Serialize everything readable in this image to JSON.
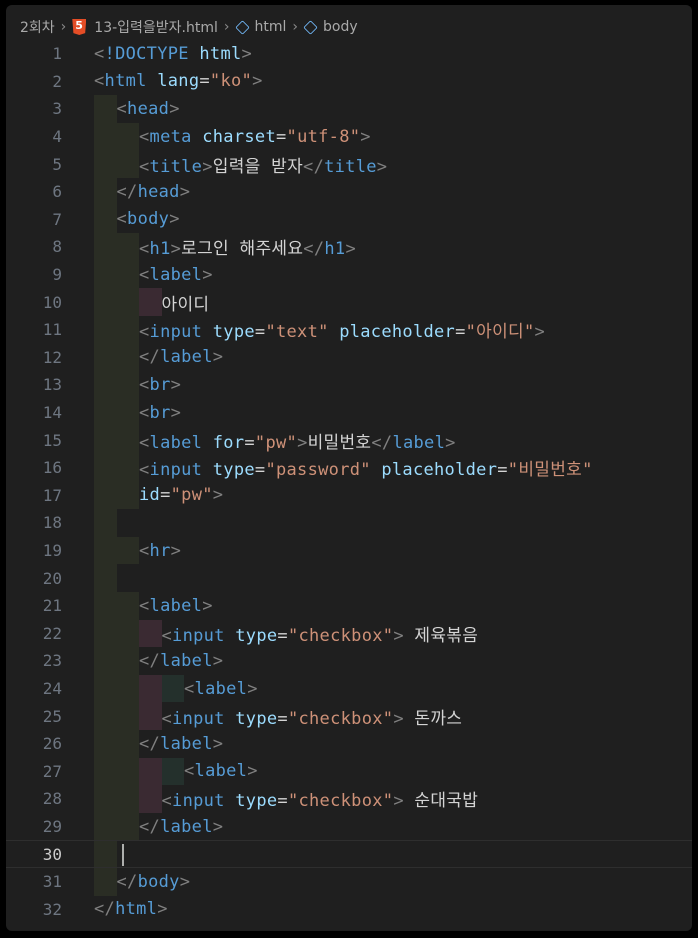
{
  "breadcrumb": {
    "folder": "2회차",
    "file": "13-입력을받자.html",
    "html": "html",
    "body": "body"
  },
  "current_line": 30,
  "lines": [
    {
      "n": "1",
      "indent": 0,
      "tokens": [
        [
          "bracket",
          "<"
        ],
        [
          "tag",
          "!DOCTYPE "
        ],
        [
          "attr",
          "html"
        ],
        [
          "bracket",
          ">"
        ]
      ]
    },
    {
      "n": "2",
      "indent": 0,
      "tokens": [
        [
          "bracket",
          "<"
        ],
        [
          "tag",
          "html "
        ],
        [
          "attr",
          "lang"
        ],
        [
          "eq",
          "="
        ],
        [
          "str",
          "\"ko\""
        ],
        [
          "bracket",
          ">"
        ]
      ]
    },
    {
      "n": "3",
      "indent": 1,
      "tokens": [
        [
          "bracket",
          "<"
        ],
        [
          "tag",
          "head"
        ],
        [
          "bracket",
          ">"
        ]
      ]
    },
    {
      "n": "4",
      "indent": 2,
      "tokens": [
        [
          "bracket",
          "<"
        ],
        [
          "tag",
          "meta "
        ],
        [
          "attr",
          "charset"
        ],
        [
          "eq",
          "="
        ],
        [
          "str",
          "\"utf-8\""
        ],
        [
          "bracket",
          ">"
        ]
      ]
    },
    {
      "n": "5",
      "indent": 2,
      "tokens": [
        [
          "bracket",
          "<"
        ],
        [
          "tag",
          "title"
        ],
        [
          "bracket",
          ">"
        ],
        [
          "txt",
          "입력을 받자"
        ],
        [
          "bracket",
          "</"
        ],
        [
          "tag",
          "title"
        ],
        [
          "bracket",
          ">"
        ]
      ]
    },
    {
      "n": "6",
      "indent": 1,
      "tokens": [
        [
          "bracket",
          "</"
        ],
        [
          "tag",
          "head"
        ],
        [
          "bracket",
          ">"
        ]
      ]
    },
    {
      "n": "7",
      "indent": 1,
      "tokens": [
        [
          "bracket",
          "<"
        ],
        [
          "tag",
          "body"
        ],
        [
          "bracket",
          ">"
        ]
      ]
    },
    {
      "n": "8",
      "indent": 2,
      "tokens": [
        [
          "bracket",
          "<"
        ],
        [
          "tag",
          "h1"
        ],
        [
          "bracket",
          ">"
        ],
        [
          "txt",
          "로그인 해주세요"
        ],
        [
          "bracket",
          "</"
        ],
        [
          "tag",
          "h1"
        ],
        [
          "bracket",
          ">"
        ]
      ]
    },
    {
      "n": "9",
      "indent": 2,
      "tokens": [
        [
          "bracket",
          "<"
        ],
        [
          "tag",
          "label"
        ],
        [
          "bracket",
          ">"
        ]
      ]
    },
    {
      "n": "10",
      "indent": 3,
      "tokens": [
        [
          "txt",
          "아이디"
        ]
      ]
    },
    {
      "n": "11",
      "indent": 2,
      "tokens": [
        [
          "bracket",
          "<"
        ],
        [
          "tag",
          "input "
        ],
        [
          "attr",
          "type"
        ],
        [
          "eq",
          "="
        ],
        [
          "str",
          "\"text\" "
        ],
        [
          "attr",
          "placeholder"
        ],
        [
          "eq",
          "="
        ],
        [
          "str",
          "\"아이디\""
        ],
        [
          "bracket",
          ">"
        ]
      ]
    },
    {
      "n": "12",
      "indent": 2,
      "tokens": [
        [
          "bracket",
          "</"
        ],
        [
          "tag",
          "label"
        ],
        [
          "bracket",
          ">"
        ]
      ]
    },
    {
      "n": "13",
      "indent": 2,
      "tokens": [
        [
          "bracket",
          "<"
        ],
        [
          "tag",
          "br"
        ],
        [
          "bracket",
          ">"
        ]
      ]
    },
    {
      "n": "14",
      "indent": 2,
      "tokens": [
        [
          "bracket",
          "<"
        ],
        [
          "tag",
          "br"
        ],
        [
          "bracket",
          ">"
        ]
      ]
    },
    {
      "n": "15",
      "indent": 2,
      "tokens": [
        [
          "bracket",
          "<"
        ],
        [
          "tag",
          "label "
        ],
        [
          "attr",
          "for"
        ],
        [
          "eq",
          "="
        ],
        [
          "str",
          "\"pw\""
        ],
        [
          "bracket",
          ">"
        ],
        [
          "txt",
          "비밀번호"
        ],
        [
          "bracket",
          "</"
        ],
        [
          "tag",
          "label"
        ],
        [
          "bracket",
          ">"
        ]
      ]
    },
    {
      "n": "16",
      "indent": 2,
      "tokens": [
        [
          "bracket",
          "<"
        ],
        [
          "tag",
          "input "
        ],
        [
          "attr",
          "type"
        ],
        [
          "eq",
          "="
        ],
        [
          "str",
          "\"password\" "
        ],
        [
          "attr",
          "placeholder"
        ],
        [
          "eq",
          "="
        ],
        [
          "str",
          "\"비밀번호\""
        ]
      ]
    },
    {
      "n": "17",
      "indent": 2,
      "tokens": [
        [
          "attr",
          "id"
        ],
        [
          "eq",
          "="
        ],
        [
          "str",
          "\"pw\""
        ],
        [
          "bracket",
          ">"
        ]
      ]
    },
    {
      "n": "18",
      "indent": 1,
      "tokens": []
    },
    {
      "n": "19",
      "indent": 2,
      "tokens": [
        [
          "bracket",
          "<"
        ],
        [
          "tag",
          "hr"
        ],
        [
          "bracket",
          ">"
        ]
      ]
    },
    {
      "n": "20",
      "indent": 1,
      "tokens": []
    },
    {
      "n": "21",
      "indent": 2,
      "tokens": [
        [
          "bracket",
          "<"
        ],
        [
          "tag",
          "label"
        ],
        [
          "bracket",
          ">"
        ]
      ]
    },
    {
      "n": "22",
      "indent": 3,
      "tokens": [
        [
          "bracket",
          "<"
        ],
        [
          "tag",
          "input "
        ],
        [
          "attr",
          "type"
        ],
        [
          "eq",
          "="
        ],
        [
          "str",
          "\"checkbox\""
        ],
        [
          "bracket",
          ">"
        ],
        [
          "txt",
          " 제육볶음"
        ]
      ]
    },
    {
      "n": "23",
      "indent": 2,
      "tokens": [
        [
          "bracket",
          "</"
        ],
        [
          "tag",
          "label"
        ],
        [
          "bracket",
          ">"
        ]
      ]
    },
    {
      "n": "24",
      "indent": 4,
      "tokens": [
        [
          "bracket",
          "<"
        ],
        [
          "tag",
          "label"
        ],
        [
          "bracket",
          ">"
        ]
      ]
    },
    {
      "n": "25",
      "indent": 3,
      "tokens": [
        [
          "bracket",
          "<"
        ],
        [
          "tag",
          "input "
        ],
        [
          "attr",
          "type"
        ],
        [
          "eq",
          "="
        ],
        [
          "str",
          "\"checkbox\""
        ],
        [
          "bracket",
          ">"
        ],
        [
          "txt",
          " 돈까스"
        ]
      ]
    },
    {
      "n": "26",
      "indent": 2,
      "tokens": [
        [
          "bracket",
          "</"
        ],
        [
          "tag",
          "label"
        ],
        [
          "bracket",
          ">"
        ]
      ]
    },
    {
      "n": "27",
      "indent": 4,
      "tokens": [
        [
          "bracket",
          "<"
        ],
        [
          "tag",
          "label"
        ],
        [
          "bracket",
          ">"
        ]
      ]
    },
    {
      "n": "28",
      "indent": 3,
      "tokens": [
        [
          "bracket",
          "<"
        ],
        [
          "tag",
          "input "
        ],
        [
          "attr",
          "type"
        ],
        [
          "eq",
          "="
        ],
        [
          "str",
          "\"checkbox\""
        ],
        [
          "bracket",
          ">"
        ],
        [
          "txt",
          " 순대국밥"
        ]
      ]
    },
    {
      "n": "29",
      "indent": 2,
      "tokens": [
        [
          "bracket",
          "</"
        ],
        [
          "tag",
          "label"
        ],
        [
          "bracket",
          ">"
        ]
      ]
    },
    {
      "n": "30",
      "indent": 1,
      "tokens": []
    },
    {
      "n": "31",
      "indent": 1,
      "tokens": [
        [
          "bracket",
          "</"
        ],
        [
          "tag",
          "body"
        ],
        [
          "bracket",
          ">"
        ]
      ]
    },
    {
      "n": "32",
      "indent": 0,
      "tokens": [
        [
          "bracket",
          "</"
        ],
        [
          "tag",
          "html"
        ],
        [
          "bracket",
          ">"
        ]
      ]
    }
  ]
}
